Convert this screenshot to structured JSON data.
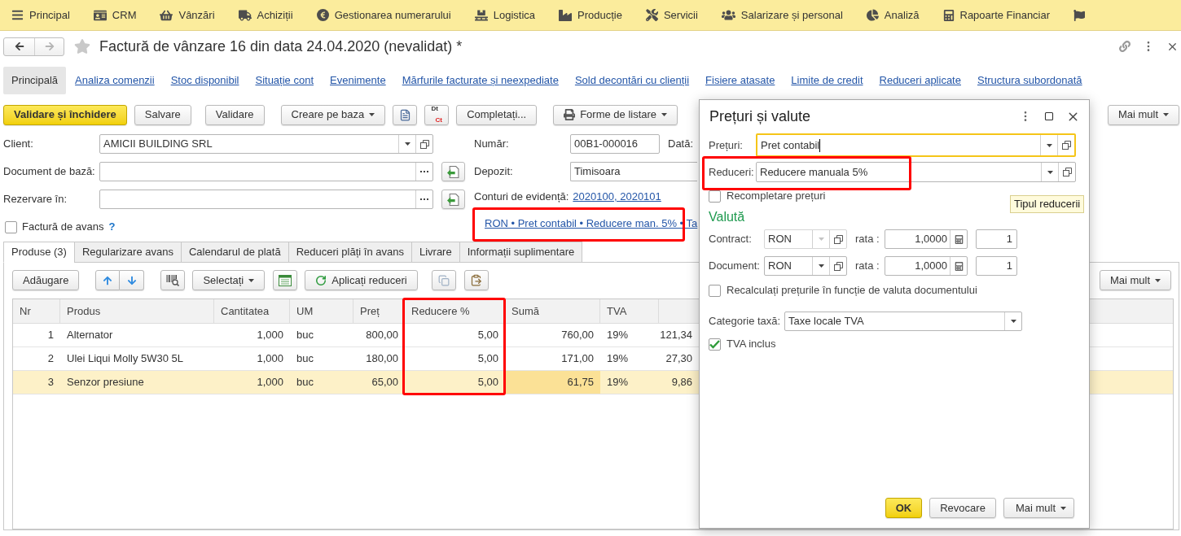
{
  "sections": [
    {
      "label": "Principal"
    },
    {
      "label": "CRM"
    },
    {
      "label": "Vânzări"
    },
    {
      "label": "Achiziții"
    },
    {
      "label": "Gestionarea numerarului"
    },
    {
      "label": "Logistica"
    },
    {
      "label": "Producție"
    },
    {
      "label": "Servicii"
    },
    {
      "label": "Salarizare și personal"
    },
    {
      "label": "Analiză"
    },
    {
      "label": "Rapoarte Financiar"
    }
  ],
  "title": "Factură de vânzare 16 din data 24.04.2020 (nevalidat) *",
  "navigation": {
    "back_disabled": false,
    "forward_disabled": true,
    "favorite": false
  },
  "form_links": [
    {
      "label": "Principală",
      "selected": true
    },
    {
      "label": "Analiza comenzii",
      "selected": false
    },
    {
      "label": "Stoc disponibil",
      "selected": false
    },
    {
      "label": "Situație cont",
      "selected": false
    },
    {
      "label": "Evenimente",
      "selected": false
    },
    {
      "label": "Mărfurile facturate și neexpediate",
      "selected": false
    },
    {
      "label": "Sold decontări cu clienții",
      "selected": false
    },
    {
      "label": "Fisiere atasate",
      "selected": false
    },
    {
      "label": "Limite de credit",
      "selected": false
    },
    {
      "label": "Reduceri aplicate",
      "selected": false
    },
    {
      "label": "Structura subordonată",
      "selected": false
    }
  ],
  "toolbar": {
    "buttons": [
      {
        "label": "Validare și închidere",
        "kind": "primary"
      },
      {
        "label": "Salvare",
        "kind": "plain"
      },
      {
        "label": "Validare",
        "kind": "plain"
      },
      {
        "label": "Creare pe baza",
        "kind": "menu"
      },
      {
        "label": "Completați...",
        "kind": "plain"
      },
      {
        "label": "Forme de listare",
        "kind": "print"
      }
    ],
    "ledger_icon": {
      "debit": "Dt",
      "credit": "Ct"
    },
    "more": {
      "label": "Mai mult",
      "kind": "menu"
    }
  },
  "fields_left": [
    {
      "label": "Client:",
      "value": "AMICII BUILDING SRL",
      "kind": "choice"
    },
    {
      "label": "Document de bază:",
      "kind": "select"
    },
    {
      "label": "Rezervare în:",
      "kind": "select"
    }
  ],
  "advance_invoice": {
    "label": "Factură de avans",
    "checked": false,
    "help": "?"
  },
  "number": {
    "label": "Număr:",
    "value": "00B1-000016"
  },
  "date": {
    "label": "Dată:"
  },
  "warehouse": {
    "label": "Depozit:",
    "value": "Timisoara"
  },
  "accounts": {
    "label": "Conturi de evidență:",
    "link": "2020100, 2020101"
  },
  "summary_link": {
    "text": "RON • Pret contabil • Reducere man. 5% • Ta",
    "highlighted": true
  },
  "tabs": [
    {
      "label": "Produse (3)",
      "selected": true
    },
    {
      "label": "Regularizare avans",
      "selected": false
    },
    {
      "label": "Calendarul de plată",
      "selected": false
    },
    {
      "label": "Reduceri plăți în avans",
      "selected": false
    },
    {
      "label": "Livrare",
      "selected": false
    },
    {
      "label": "Informații suplimentare",
      "selected": false
    }
  ],
  "table_toolbar": {
    "buttons": [
      {
        "label": "Adăugare",
        "kind": "plain"
      },
      {
        "label": "Selectați",
        "kind": "menu"
      },
      {
        "label": "Aplicați reduceri",
        "kind": "refresh"
      }
    ],
    "more": {
      "label": "Mai mult",
      "kind": "menu"
    }
  },
  "table": {
    "columns": [
      {
        "label": "Nr",
        "current": false,
        "highlighted": false
      },
      {
        "label": "Produs",
        "current": false,
        "highlighted": false
      },
      {
        "label": "Cantitatea",
        "current": false,
        "highlighted": false
      },
      {
        "label": "UM",
        "current": false,
        "highlighted": false
      },
      {
        "label": "Preț",
        "current": false,
        "highlighted": false
      },
      {
        "label": "Reducere %",
        "current": false,
        "highlighted": true
      },
      {
        "label": "Sumă",
        "current": true,
        "highlighted": false
      },
      {
        "label": "TVA",
        "current": false,
        "highlighted": false
      },
      {
        "current": false,
        "highlighted": false
      }
    ],
    "rows": [
      {
        "cells": [
          "1",
          "Alternator",
          "1,000",
          "buc",
          "800,00",
          "5,00",
          "760,00",
          "19%",
          "121,34"
        ],
        "selected": false
      },
      {
        "cells": [
          "2",
          "Ulei Liqui Molly 5W30 5L",
          "1,000",
          "buc",
          "180,00",
          "5,00",
          "171,00",
          "19%",
          "27,30"
        ],
        "selected": false
      },
      {
        "cells": [
          "3",
          "Senzor presiune",
          "1,000",
          "buc",
          "65,00",
          "5,00",
          "61,75",
          "19%",
          "9,86"
        ],
        "selected": true
      }
    ]
  },
  "dialog": {
    "title": "Prețuri și valute",
    "prices": {
      "label": "Prețuri:",
      "value": "Pret contabil",
      "focused": true
    },
    "discounts": {
      "label": "Reduceri:",
      "value": "Reducere manuala 5%",
      "focused": false,
      "highlighted": true
    },
    "refill_prices": {
      "label": "Recompletare prețuri",
      "checked": false
    },
    "tooltip": "Tipul reducerii",
    "currency_heading": "Valută",
    "currency_rows": [
      {
        "label": "Contract:",
        "currency": "RON",
        "disabled": true,
        "rate_label": "rata :",
        "rate": "1,0000",
        "multiplier": "1"
      },
      {
        "label": "Document:",
        "currency": "RON",
        "disabled": false,
        "rate_label": "rata :",
        "rate": "1,0000",
        "multiplier": "1"
      }
    ],
    "recalculate": {
      "label": "Recalculați prețurile în funcție de valuta documentului",
      "checked": false
    },
    "tax_category": {
      "label": "Categorie taxă:",
      "value": "Taxe locale TVA"
    },
    "vat_included": {
      "label": "TVA inclus",
      "checked": true
    },
    "buttons": [
      {
        "label": "OK",
        "kind": "primary"
      },
      {
        "label": "Revocare",
        "kind": "plain"
      },
      {
        "label": "Mai mult",
        "kind": "menu"
      }
    ]
  }
}
